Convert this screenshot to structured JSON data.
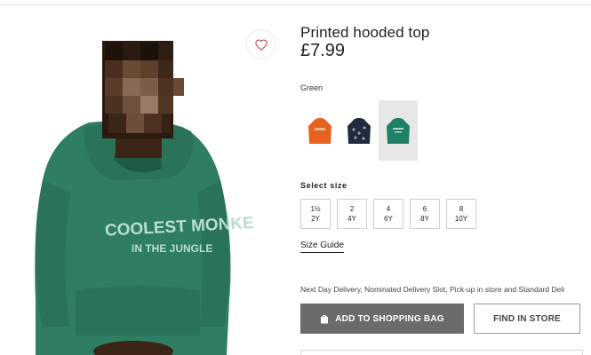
{
  "product": {
    "title": "Printed hooded top",
    "price": "£7.99",
    "color_name": "Green",
    "image_text_line1": "COOLEST MONKE",
    "image_text_line2": "IN THE JUNGLE"
  },
  "swatches": [
    {
      "color": "orange",
      "hex": "#e8621f"
    },
    {
      "color": "navy",
      "hex": "#1f2b3c"
    },
    {
      "color": "green",
      "hex": "#1f7f66",
      "selected": true
    }
  ],
  "size_section": {
    "label": "Select size",
    "sizes": [
      {
        "top": "1½",
        "bottom": "2Y"
      },
      {
        "top": "2",
        "bottom": "4Y"
      },
      {
        "top": "4",
        "bottom": "6Y"
      },
      {
        "top": "6",
        "bottom": "8Y"
      },
      {
        "top": "8",
        "bottom": "10Y"
      }
    ],
    "guide_label": "Size Guide"
  },
  "delivery_text": "Next Day Delivery, Nominated Delivery Slot, Pick-up in store and Standard Deli",
  "actions": {
    "add_to_bag": "ADD TO SHOPPING BAG",
    "find_in_store": "FIND IN STORE"
  },
  "icons": {
    "wishlist": "heart-icon",
    "bag": "shopping-bag-icon"
  },
  "colors": {
    "hoodie_green": "#2f7d62",
    "button_grey": "#6b6b6b"
  }
}
